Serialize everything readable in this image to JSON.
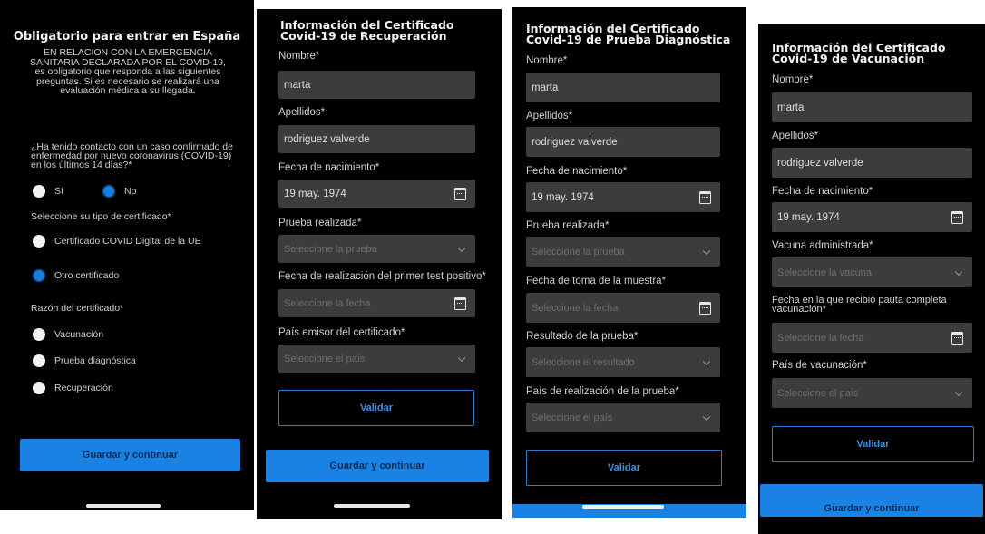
{
  "panel1": {
    "title": "Obligatorio para entrar en España",
    "intro": "EN RELACION CON LA EMERGENCIA SANITARIA DECLARADA POR EL COVID-19, es obligatorio que responda a las siguientes preguntas. Si es necesario se realizará una evaluación médica a su llegada.",
    "question": "¿Ha tenido contacto con un caso confirmado de enfermedad por nuevo coronavirus (COVID-19) en los últimos 14 días?*",
    "yes": "Sí",
    "no": "No",
    "cert_type_label": "Seleccione su tipo de certificado*",
    "cert_opt1": "Certificado COVID Digital de la UE",
    "cert_opt2": "Otro certificado",
    "reason_label": "Razón del certificado*",
    "reason1": "Vacunación",
    "reason2": "Prueba diagnóstica",
    "reason3": "Recuperación",
    "save": "Guardar y continuar"
  },
  "panel2": {
    "title1": "Información del Certificado",
    "title2": "Covid-19 de Recuperación",
    "name_label": "Nombre*",
    "name_value": "marta",
    "surname_label": "Apellidos*",
    "surname_value": "rodriguez valverde",
    "dob_label": "Fecha de nacimiento*",
    "dob_value": "19 may. 1974",
    "test_label": "Prueba realizada*",
    "test_ph": "Seleccione la prueba",
    "first_test_label": "Fecha de realización del primer test positivo*",
    "first_test_ph": "Seleccione la fecha",
    "country_label": "País emisor del certificado*",
    "country_ph": "Seleccione el país",
    "validate": "Validar",
    "save": "Guardar y continuar"
  },
  "panel3": {
    "title1": "Información del Certificado",
    "title2": "Covid-19 de Prueba Diagnóstica",
    "name_label": "Nombre*",
    "name_value": "marta",
    "surname_label": "Apellidos*",
    "surname_value": "rodriguez valverde",
    "dob_label": "Fecha de nacimiento*",
    "dob_value": "19 may. 1974",
    "test_label": "Prueba realizada*",
    "test_ph": "Seleccione la prueba",
    "sample_label": "Fecha de toma de la muestra*",
    "sample_ph": "Seleccione la fecha",
    "result_label": "Resultado de la prueba*",
    "result_ph": "Seleccione el resultado",
    "country_label": "País de realización de la prueba*",
    "country_ph": "Seleccione el país",
    "validate": "Validar"
  },
  "panel4": {
    "title1": "Información del Certificado",
    "title2": "Covid-19 de Vacunación",
    "name_label": "Nombre*",
    "name_value": "marta",
    "surname_label": "Apellidos*",
    "surname_value": "rodriguez valverde",
    "dob_label": "Fecha de nacimiento*",
    "dob_value": "19 may. 1974",
    "vaccine_label": "Vacuna administrada*",
    "vaccine_ph": "Seleccione la vacuna",
    "complete_label": "Fecha en la que recibió pauta completa vacunación*",
    "complete_ph": "Seleccione la fecha",
    "country_label": "País de vacunación*",
    "country_ph": "Seleccione el país",
    "validate": "Validar",
    "save": "Guardar y continuar"
  },
  "colors": {
    "accent": "#1a82e2",
    "field": "#3c3c3c",
    "background": "#000000"
  }
}
